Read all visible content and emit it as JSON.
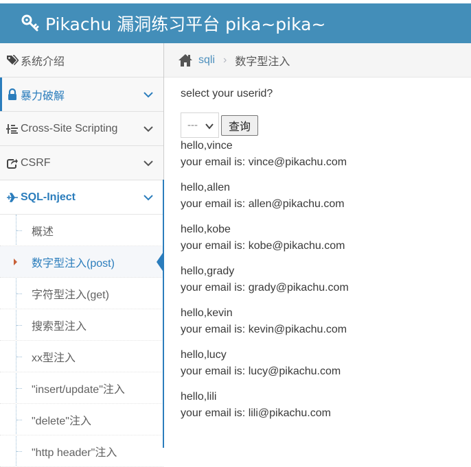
{
  "header": {
    "title": "Pikachu 漏洞练习平台 pika~pika~"
  },
  "sidebar": {
    "items": [
      {
        "label": "系统介绍",
        "icon": "tags-icon"
      },
      {
        "label": "暴力破解",
        "icon": "lock-icon"
      },
      {
        "label": "Cross-Site Scripting",
        "icon": "list-tree-icon"
      },
      {
        "label": "CSRF",
        "icon": "share-icon"
      },
      {
        "label": "SQL-Inject",
        "icon": "plane-icon"
      }
    ],
    "submenu": [
      {
        "label": "概述"
      },
      {
        "label": "数字型注入(post)"
      },
      {
        "label": "字符型注入(get)"
      },
      {
        "label": "搜索型注入"
      },
      {
        "label": "xx型注入"
      },
      {
        "label": "\"insert/update\"注入"
      },
      {
        "label": "\"delete\"注入"
      },
      {
        "label": "\"http header\"注入"
      }
    ]
  },
  "breadcrumb": {
    "link": "sqli",
    "separator": "›",
    "current": "数字型注入"
  },
  "main": {
    "prompt": "select your userid?",
    "select_value": "---",
    "query_button": "查询",
    "results": [
      {
        "greeting": "hello,vince",
        "email_line": "your email is: vince@pikachu.com"
      },
      {
        "greeting": "hello,allen",
        "email_line": "your email is: allen@pikachu.com"
      },
      {
        "greeting": "hello,kobe",
        "email_line": "your email is: kobe@pikachu.com"
      },
      {
        "greeting": "hello,grady",
        "email_line": "your email is: grady@pikachu.com"
      },
      {
        "greeting": "hello,kevin",
        "email_line": "your email is: kevin@pikachu.com"
      },
      {
        "greeting": "hello,lucy",
        "email_line": "your email is: lucy@pikachu.com"
      },
      {
        "greeting": "hello,lili",
        "email_line": "your email is: lili@pikachu.com"
      }
    ]
  },
  "colors": {
    "topbar": "#438eb9",
    "accent": "#2b7dbc",
    "active_caret": "#c86139"
  }
}
